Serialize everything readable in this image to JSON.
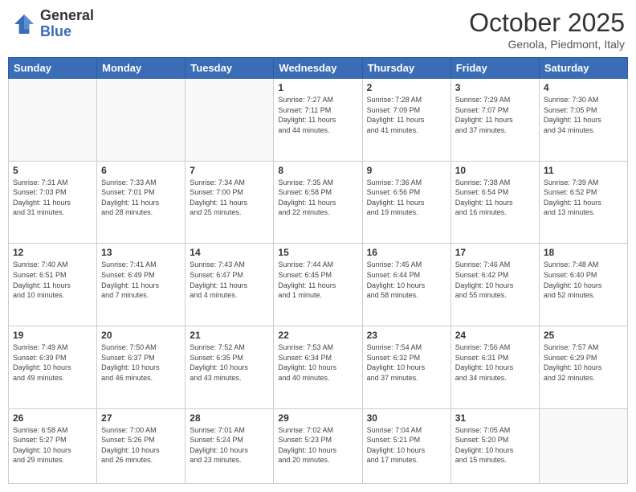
{
  "header": {
    "logo_general": "General",
    "logo_blue": "Blue",
    "month_title": "October 2025",
    "location": "Genola, Piedmont, Italy"
  },
  "days_of_week": [
    "Sunday",
    "Monday",
    "Tuesday",
    "Wednesday",
    "Thursday",
    "Friday",
    "Saturday"
  ],
  "weeks": [
    [
      {
        "day": "",
        "info": ""
      },
      {
        "day": "",
        "info": ""
      },
      {
        "day": "",
        "info": ""
      },
      {
        "day": "1",
        "info": "Sunrise: 7:27 AM\nSunset: 7:11 PM\nDaylight: 11 hours\nand 44 minutes."
      },
      {
        "day": "2",
        "info": "Sunrise: 7:28 AM\nSunset: 7:09 PM\nDaylight: 11 hours\nand 41 minutes."
      },
      {
        "day": "3",
        "info": "Sunrise: 7:29 AM\nSunset: 7:07 PM\nDaylight: 11 hours\nand 37 minutes."
      },
      {
        "day": "4",
        "info": "Sunrise: 7:30 AM\nSunset: 7:05 PM\nDaylight: 11 hours\nand 34 minutes."
      }
    ],
    [
      {
        "day": "5",
        "info": "Sunrise: 7:31 AM\nSunset: 7:03 PM\nDaylight: 11 hours\nand 31 minutes."
      },
      {
        "day": "6",
        "info": "Sunrise: 7:33 AM\nSunset: 7:01 PM\nDaylight: 11 hours\nand 28 minutes."
      },
      {
        "day": "7",
        "info": "Sunrise: 7:34 AM\nSunset: 7:00 PM\nDaylight: 11 hours\nand 25 minutes."
      },
      {
        "day": "8",
        "info": "Sunrise: 7:35 AM\nSunset: 6:58 PM\nDaylight: 11 hours\nand 22 minutes."
      },
      {
        "day": "9",
        "info": "Sunrise: 7:36 AM\nSunset: 6:56 PM\nDaylight: 11 hours\nand 19 minutes."
      },
      {
        "day": "10",
        "info": "Sunrise: 7:38 AM\nSunset: 6:54 PM\nDaylight: 11 hours\nand 16 minutes."
      },
      {
        "day": "11",
        "info": "Sunrise: 7:39 AM\nSunset: 6:52 PM\nDaylight: 11 hours\nand 13 minutes."
      }
    ],
    [
      {
        "day": "12",
        "info": "Sunrise: 7:40 AM\nSunset: 6:51 PM\nDaylight: 11 hours\nand 10 minutes."
      },
      {
        "day": "13",
        "info": "Sunrise: 7:41 AM\nSunset: 6:49 PM\nDaylight: 11 hours\nand 7 minutes."
      },
      {
        "day": "14",
        "info": "Sunrise: 7:43 AM\nSunset: 6:47 PM\nDaylight: 11 hours\nand 4 minutes."
      },
      {
        "day": "15",
        "info": "Sunrise: 7:44 AM\nSunset: 6:45 PM\nDaylight: 11 hours\nand 1 minute."
      },
      {
        "day": "16",
        "info": "Sunrise: 7:45 AM\nSunset: 6:44 PM\nDaylight: 10 hours\nand 58 minutes."
      },
      {
        "day": "17",
        "info": "Sunrise: 7:46 AM\nSunset: 6:42 PM\nDaylight: 10 hours\nand 55 minutes."
      },
      {
        "day": "18",
        "info": "Sunrise: 7:48 AM\nSunset: 6:40 PM\nDaylight: 10 hours\nand 52 minutes."
      }
    ],
    [
      {
        "day": "19",
        "info": "Sunrise: 7:49 AM\nSunset: 6:39 PM\nDaylight: 10 hours\nand 49 minutes."
      },
      {
        "day": "20",
        "info": "Sunrise: 7:50 AM\nSunset: 6:37 PM\nDaylight: 10 hours\nand 46 minutes."
      },
      {
        "day": "21",
        "info": "Sunrise: 7:52 AM\nSunset: 6:35 PM\nDaylight: 10 hours\nand 43 minutes."
      },
      {
        "day": "22",
        "info": "Sunrise: 7:53 AM\nSunset: 6:34 PM\nDaylight: 10 hours\nand 40 minutes."
      },
      {
        "day": "23",
        "info": "Sunrise: 7:54 AM\nSunset: 6:32 PM\nDaylight: 10 hours\nand 37 minutes."
      },
      {
        "day": "24",
        "info": "Sunrise: 7:56 AM\nSunset: 6:31 PM\nDaylight: 10 hours\nand 34 minutes."
      },
      {
        "day": "25",
        "info": "Sunrise: 7:57 AM\nSunset: 6:29 PM\nDaylight: 10 hours\nand 32 minutes."
      }
    ],
    [
      {
        "day": "26",
        "info": "Sunrise: 6:58 AM\nSunset: 5:27 PM\nDaylight: 10 hours\nand 29 minutes."
      },
      {
        "day": "27",
        "info": "Sunrise: 7:00 AM\nSunset: 5:26 PM\nDaylight: 10 hours\nand 26 minutes."
      },
      {
        "day": "28",
        "info": "Sunrise: 7:01 AM\nSunset: 5:24 PM\nDaylight: 10 hours\nand 23 minutes."
      },
      {
        "day": "29",
        "info": "Sunrise: 7:02 AM\nSunset: 5:23 PM\nDaylight: 10 hours\nand 20 minutes."
      },
      {
        "day": "30",
        "info": "Sunrise: 7:04 AM\nSunset: 5:21 PM\nDaylight: 10 hours\nand 17 minutes."
      },
      {
        "day": "31",
        "info": "Sunrise: 7:05 AM\nSunset: 5:20 PM\nDaylight: 10 hours\nand 15 minutes."
      },
      {
        "day": "",
        "info": ""
      }
    ]
  ]
}
